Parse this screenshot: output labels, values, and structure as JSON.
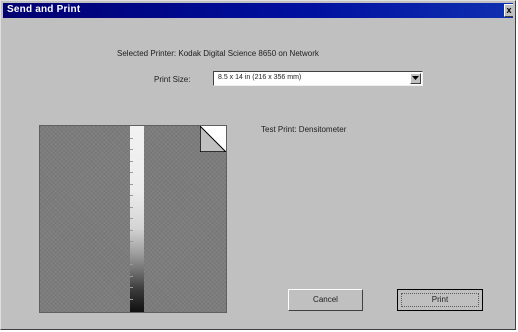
{
  "window": {
    "title": "Send and Print",
    "close_glyph": "x"
  },
  "printer": {
    "text": "Selected Printer: Kodak Digital Science 8650 on Network"
  },
  "print_size": {
    "label": "Print Size:",
    "selected_value": "8.5 x 14 in (216 x 356 mm)"
  },
  "preview": {
    "caption": "Test Print: Densitometer"
  },
  "buttons": {
    "cancel_label": "Cancel",
    "print_label": "Print"
  },
  "icons": {
    "dropdown": "chevron-down-icon",
    "page_fold": "page-fold-icon",
    "close": "close-icon"
  }
}
